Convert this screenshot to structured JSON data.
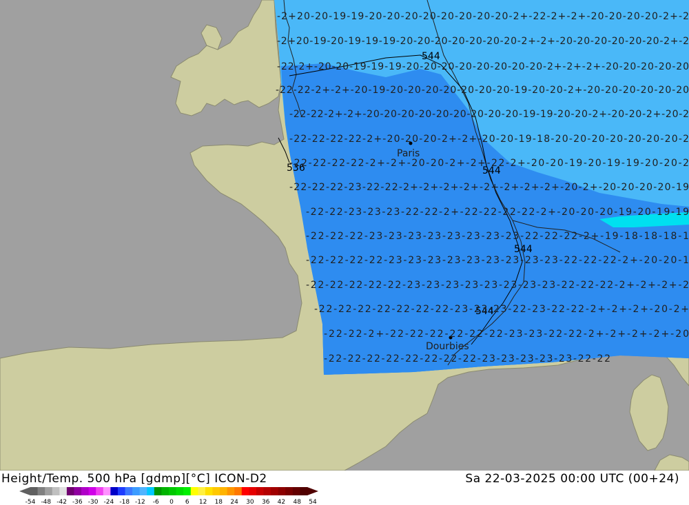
{
  "header": {
    "title": "Height/Temp. 500 hPa [gdmp][°C] ICON-D2",
    "valid_time": "Sa 22-03-2025 00:00 UTC (00+24)"
  },
  "colors": {
    "sea": "#a0a0a0",
    "land": "#cdcda0",
    "coast": "#8a8a70",
    "band_minus_20": "#4ab8f8",
    "band_minus_22": "#2e8cf0",
    "band_minus_18": "#00e0f0",
    "isotherm_text": "#202020"
  },
  "cities": [
    {
      "name": "Paris"
    },
    {
      "name": "Dourbies"
    }
  ],
  "height_contours": [
    {
      "label": "544"
    },
    {
      "label": "544"
    },
    {
      "label": "544"
    },
    {
      "label": "544"
    },
    {
      "label": "536"
    }
  ],
  "isotherm_rows": [
    {
      "text": "-2+20-20-19-19-20-20-20-20-20-20-20-20-2+-22-2+-2+-20-20-20-20-2+-2"
    },
    {
      "text": "-2+20-19-20-19-19-19-20-20-20-20-20-20-20-2+-2+-20-20-20-20-20-20-2+-2"
    },
    {
      "text": "-22-2+-20-20-19-19-19-20-20-20-20-20-20-20-20-2+-2+-2+-20-20-20-20-20"
    },
    {
      "text": "-22-22-2+-2+-20-19-20-20-20-20-20-20-20-19-20-20-2+-20-20-20-20-20-20"
    },
    {
      "text": "-22-22-2+-2+-20-20-20-20-20-20-20-20-20-19-19-20-20-2+-20-20-2+-20-2"
    },
    {
      "text": "-22-22-22-22-2+-20-20-20-2+-2+-20-20-19-18-20-20-20-20-20-20-20-2"
    },
    {
      "text": "-22-22-22-22-2+-2+-20-20-2+-2+-22-2+-20-20-19-20-19-19-20-20-2"
    },
    {
      "text": "-22-22-22-23-22-22-2+-2+-2+-2+-2+-2+-2+-2+-20-2+-20-20-20-20-19"
    },
    {
      "text": "-22-22-23-23-23-22-22-2+-22-22-22-22-2+-20-20-20-19-20-19-19"
    },
    {
      "text": "-22-22-22-23-23-23-23-23-23-23-23-22-22-22-2+-19-18-18-18-1"
    },
    {
      "text": "-22-22-22-22-23-23-23-23-23-23-23-23-23-22-22-22-2+-20-20-1"
    },
    {
      "text": "-22-22-22-22-22-23-23-23-23-23-23-23-23-22-22-22-2+-2+-2+-2"
    },
    {
      "text": "-22-22-22-22-22-22-22-23-23-23-22-23-22-22-2+-2+-2+-20-2+"
    },
    {
      "text": "-22-22-2+-22-22-22-22-22-22-23-23-22-22-2+-2+-2+-2+-20"
    },
    {
      "text": "-22-22-22-22-22-22-22-22-23-23-23-23-23-22-22"
    }
  ],
  "colorbar": {
    "ticks": [
      "-54",
      "-48",
      "-42",
      "-36",
      "-30",
      "-24",
      "-18",
      "-12",
      "-6",
      "0",
      "6",
      "12",
      "18",
      "24",
      "30",
      "36",
      "42",
      "48",
      "54"
    ],
    "colors": [
      "#606060",
      "#808080",
      "#a0a0a0",
      "#c0c0c0",
      "#e0e0e0",
      "#700070",
      "#9000a0",
      "#b000c8",
      "#d000e8",
      "#f040f0",
      "#ff90ff",
      "#0000c8",
      "#1e3cff",
      "#3c78ff",
      "#3c9cff",
      "#50b4ff",
      "#00c8ff",
      "#009600",
      "#00b400",
      "#00c800",
      "#00dc00",
      "#00f000",
      "#ffff00",
      "#fff040",
      "#ffe000",
      "#ffc800",
      "#ffb400",
      "#ff9600",
      "#ff7800",
      "#ff0000",
      "#e60000",
      "#c80000",
      "#b40000",
      "#a00000",
      "#8c0000",
      "#780000",
      "#640000",
      "#500000"
    ]
  }
}
